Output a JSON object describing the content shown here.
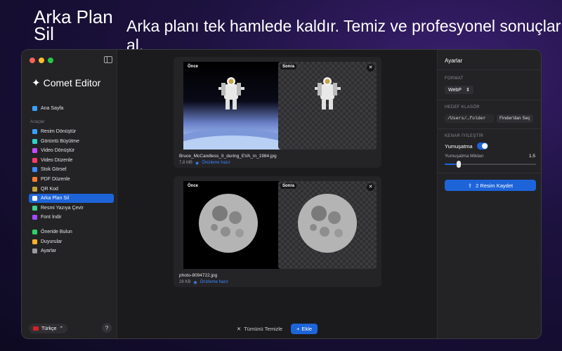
{
  "hero": {
    "title": "Arka Plan Sil",
    "subtitle": "Arka planı tek hamlede kaldır. Temiz ve profesyonel sonuçlar al."
  },
  "sidebar": {
    "app_name": "Comet Editor",
    "home": "Ana Sayfa",
    "tools_label": "Araçlar",
    "tools": [
      {
        "label": "Resim Dönüştür",
        "icon": "image-convert-icon",
        "color": "#3aa0ff"
      },
      {
        "label": "Görüntü Büyütme",
        "icon": "upscale-icon",
        "color": "#2fd0c8"
      },
      {
        "label": "Video Dönüştür",
        "icon": "video-convert-icon",
        "color": "#c44bff"
      },
      {
        "label": "Video Düzenle",
        "icon": "video-edit-icon",
        "color": "#ff3a6a"
      },
      {
        "label": "Stok Görsel",
        "icon": "stock-image-icon",
        "color": "#3f8cff"
      },
      {
        "label": "PDF Düzenle",
        "icon": "pdf-icon",
        "color": "#ff7a2f"
      },
      {
        "label": "QR Kod",
        "icon": "qr-code-icon",
        "color": "#c9a23a"
      },
      {
        "label": "Arka Plan Sil",
        "icon": "remove-background-icon",
        "color": "#ffffff"
      },
      {
        "label": "Resmi Yazıya Çevir",
        "icon": "ocr-icon",
        "color": "#3fd08a"
      },
      {
        "label": "Font İndir",
        "icon": "font-icon",
        "color": "#a04bff"
      }
    ],
    "active_index": 7,
    "extras": [
      {
        "label": "Öneride Bulun",
        "icon": "feedback-icon",
        "color": "#2fd06a"
      },
      {
        "label": "Duyurular",
        "icon": "bell-icon",
        "color": "#ffb02f"
      },
      {
        "label": "Ayarlar",
        "icon": "gear-icon",
        "color": "#9a9aa0"
      }
    ],
    "language": "Türkçe",
    "help": "?"
  },
  "cards": [
    {
      "before_label": "Önce",
      "after_label": "Sonra",
      "file_name": "Bruce_McCandless_II_during_EVA_in_1984.jpg",
      "size": "7,8 MB",
      "status": "Önizleme hazır",
      "subject": "astronaut"
    },
    {
      "before_label": "Önce",
      "after_label": "Sonra",
      "file_name": "photo-8094722.jpg",
      "size": "28 KB",
      "status": "Önizleme hazır",
      "subject": "moon"
    }
  ],
  "bottom": {
    "clear_label": "Tümünü Temizle",
    "add_label": "Ekle"
  },
  "panel": {
    "title": "Ayarlar",
    "format_label": "FORMAT",
    "format_value": "WebP",
    "folder_label": "HEDEF KLASÖR",
    "folder_value": "/Users/…folder",
    "finder_button": "Finder'dan Seç",
    "edge_label": "KENAR İYİLEŞTİR",
    "smoothing_label": "Yumuşatma",
    "smoothing_on": true,
    "amount_label": "Yumuşatma Miktarı",
    "amount_value": "1.5",
    "amount_fraction": 0.15,
    "save_button": "2 Resim Kaydet"
  }
}
